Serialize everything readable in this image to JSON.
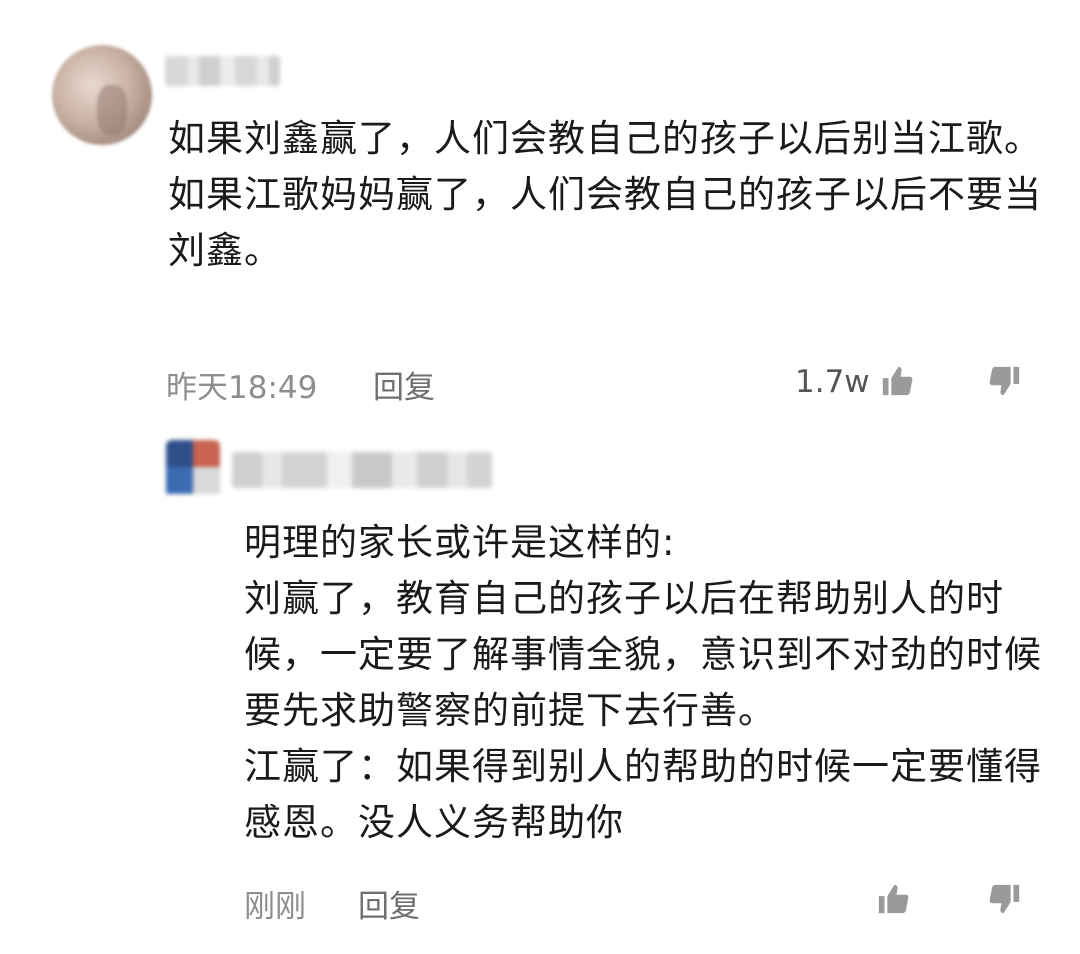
{
  "comment": {
    "text": "如果刘鑫赢了，人们会教自己的孩子以后别当江歌。\n如果江歌妈妈赢了，人们会教自己的孩子以后不要当刘鑫。",
    "time": "昨天18:49",
    "reply_label": "回复",
    "like_count": "1.7w",
    "icons": {
      "like": "thumbs-up-icon",
      "dislike": "thumbs-down-icon"
    }
  },
  "reply": {
    "text": "明理的家长或许是这样的:\n刘赢了，教育自己的孩子以后在帮助别人的时候，一定要了解事情全貌，意识到不对劲的时候要先求助警察的前提下去行善。\n江赢了：如果得到别人的帮助的时候一定要懂得感恩。没人义务帮助你",
    "time": "刚刚",
    "reply_label": "回复",
    "icons": {
      "like": "thumbs-up-icon",
      "dislike": "thumbs-down-icon"
    }
  },
  "colors": {
    "text": "#1a1a1a",
    "meta": "#8e8e8e",
    "icon": "#9a9a9a"
  }
}
